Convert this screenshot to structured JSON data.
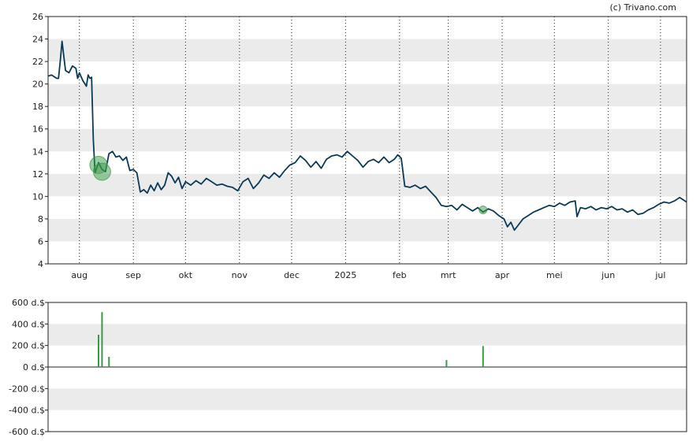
{
  "watermark": "(c) Trivano.com",
  "chart_data": [
    {
      "type": "line",
      "title": "",
      "xlabel": "",
      "ylabel": "",
      "ylim": [
        4,
        26
      ],
      "yticks": [
        "4",
        "6",
        "8",
        "10",
        "12",
        "14",
        "16",
        "18",
        "20",
        "22",
        "24",
        "26"
      ],
      "xlim": [
        "2024-07-14",
        "2025-07-16"
      ],
      "xticks": [
        {
          "label": "aug",
          "date": "2024-08-01"
        },
        {
          "label": "sep",
          "date": "2024-09-01"
        },
        {
          "label": "okt",
          "date": "2024-10-01"
        },
        {
          "label": "nov",
          "date": "2024-11-01"
        },
        {
          "label": "dec",
          "date": "2024-12-01"
        },
        {
          "label": "2025",
          "date": "2025-01-01"
        },
        {
          "label": "feb",
          "date": "2025-02-01"
        },
        {
          "label": "mrt",
          "date": "2025-03-01"
        },
        {
          "label": "apr",
          "date": "2025-04-01"
        },
        {
          "label": "mei",
          "date": "2025-05-01"
        },
        {
          "label": "jun",
          "date": "2025-06-01"
        },
        {
          "label": "jul",
          "date": "2025-07-01"
        }
      ],
      "grid": "vertical dotted lines at months, alternating horizontal bands",
      "line_color": "#0b3a57",
      "series": [
        {
          "points": [
            [
              "2024-07-14",
              20.7
            ],
            [
              "2024-07-16",
              20.8
            ],
            [
              "2024-07-19",
              20.5
            ],
            [
              "2024-07-20",
              20.5
            ],
            [
              "2024-07-21",
              22.0
            ],
            [
              "2024-07-22",
              23.8
            ],
            [
              "2024-07-23",
              22.5
            ],
            [
              "2024-07-24",
              21.2
            ],
            [
              "2024-07-26",
              21.0
            ],
            [
              "2024-07-28",
              21.6
            ],
            [
              "2024-07-30",
              21.4
            ],
            [
              "2024-07-31",
              20.5
            ],
            [
              "2024-08-01",
              21.0
            ],
            [
              "2024-08-03",
              20.3
            ],
            [
              "2024-08-05",
              19.8
            ],
            [
              "2024-08-06",
              20.8
            ],
            [
              "2024-08-07",
              20.5
            ],
            [
              "2024-08-08",
              20.6
            ],
            [
              "2024-08-09",
              15.0
            ],
            [
              "2024-08-10",
              12.1
            ],
            [
              "2024-08-12",
              13.0
            ],
            [
              "2024-08-14",
              12.4
            ],
            [
              "2024-08-16",
              12.2
            ],
            [
              "2024-08-18",
              13.8
            ],
            [
              "2024-08-20",
              14.0
            ],
            [
              "2024-08-22",
              13.5
            ],
            [
              "2024-08-24",
              13.6
            ],
            [
              "2024-08-26",
              13.2
            ],
            [
              "2024-08-28",
              13.5
            ],
            [
              "2024-08-30",
              12.3
            ],
            [
              "2024-09-01",
              12.4
            ],
            [
              "2024-09-03",
              12.1
            ],
            [
              "2024-09-05",
              10.4
            ],
            [
              "2024-09-07",
              10.6
            ],
            [
              "2024-09-09",
              10.3
            ],
            [
              "2024-09-11",
              11.0
            ],
            [
              "2024-09-13",
              10.5
            ],
            [
              "2024-09-15",
              11.2
            ],
            [
              "2024-09-17",
              10.6
            ],
            [
              "2024-09-19",
              11.0
            ],
            [
              "2024-09-21",
              12.1
            ],
            [
              "2024-09-23",
              11.8
            ],
            [
              "2024-09-25",
              11.2
            ],
            [
              "2024-09-27",
              11.7
            ],
            [
              "2024-09-29",
              10.7
            ],
            [
              "2024-10-01",
              11.3
            ],
            [
              "2024-10-04",
              11.0
            ],
            [
              "2024-10-07",
              11.4
            ],
            [
              "2024-10-10",
              11.1
            ],
            [
              "2024-10-13",
              11.6
            ],
            [
              "2024-10-16",
              11.3
            ],
            [
              "2024-10-19",
              11.0
            ],
            [
              "2024-10-22",
              11.1
            ],
            [
              "2024-10-25",
              10.9
            ],
            [
              "2024-10-28",
              10.8
            ],
            [
              "2024-10-31",
              10.5
            ],
            [
              "2024-11-03",
              11.3
            ],
            [
              "2024-11-06",
              11.6
            ],
            [
              "2024-11-09",
              10.7
            ],
            [
              "2024-11-12",
              11.2
            ],
            [
              "2024-11-15",
              11.9
            ],
            [
              "2024-11-18",
              11.6
            ],
            [
              "2024-11-21",
              12.1
            ],
            [
              "2024-11-24",
              11.7
            ],
            [
              "2024-11-27",
              12.3
            ],
            [
              "2024-11-30",
              12.8
            ],
            [
              "2024-12-03",
              13.0
            ],
            [
              "2024-12-06",
              13.6
            ],
            [
              "2024-12-09",
              13.2
            ],
            [
              "2024-12-12",
              12.6
            ],
            [
              "2024-12-15",
              13.1
            ],
            [
              "2024-12-18",
              12.5
            ],
            [
              "2024-12-21",
              13.3
            ],
            [
              "2024-12-24",
              13.6
            ],
            [
              "2024-12-27",
              13.7
            ],
            [
              "2024-12-30",
              13.5
            ],
            [
              "2025-01-02",
              14.0
            ],
            [
              "2025-01-05",
              13.6
            ],
            [
              "2025-01-08",
              13.2
            ],
            [
              "2025-01-11",
              12.6
            ],
            [
              "2025-01-14",
              13.1
            ],
            [
              "2025-01-17",
              13.3
            ],
            [
              "2025-01-20",
              13.0
            ],
            [
              "2025-01-23",
              13.5
            ],
            [
              "2025-01-26",
              13.0
            ],
            [
              "2025-01-29",
              13.3
            ],
            [
              "2025-01-31",
              13.7
            ],
            [
              "2025-02-02",
              13.4
            ],
            [
              "2025-02-04",
              10.9
            ],
            [
              "2025-02-07",
              10.8
            ],
            [
              "2025-02-10",
              11.0
            ],
            [
              "2025-02-13",
              10.7
            ],
            [
              "2025-02-16",
              10.9
            ],
            [
              "2025-02-19",
              10.4
            ],
            [
              "2025-02-22",
              9.9
            ],
            [
              "2025-02-25",
              9.2
            ],
            [
              "2025-02-28",
              9.1
            ],
            [
              "2025-03-03",
              9.2
            ],
            [
              "2025-03-06",
              8.8
            ],
            [
              "2025-03-09",
              9.3
            ],
            [
              "2025-03-12",
              9.0
            ],
            [
              "2025-03-15",
              8.7
            ],
            [
              "2025-03-18",
              9.0
            ],
            [
              "2025-03-21",
              8.6
            ],
            [
              "2025-03-24",
              8.9
            ],
            [
              "2025-03-27",
              8.7
            ],
            [
              "2025-03-30",
              8.3
            ],
            [
              "2025-04-02",
              8.0
            ],
            [
              "2025-04-04",
              7.3
            ],
            [
              "2025-04-06",
              7.7
            ],
            [
              "2025-04-08",
              7.0
            ],
            [
              "2025-04-10",
              7.4
            ],
            [
              "2025-04-13",
              8.0
            ],
            [
              "2025-04-16",
              8.3
            ],
            [
              "2025-04-19",
              8.6
            ],
            [
              "2025-04-22",
              8.8
            ],
            [
              "2025-04-25",
              9.0
            ],
            [
              "2025-04-28",
              9.2
            ],
            [
              "2025-05-01",
              9.1
            ],
            [
              "2025-05-04",
              9.4
            ],
            [
              "2025-05-07",
              9.2
            ],
            [
              "2025-05-10",
              9.5
            ],
            [
              "2025-05-13",
              9.6
            ],
            [
              "2025-05-14",
              8.2
            ],
            [
              "2025-05-16",
              9.0
            ],
            [
              "2025-05-19",
              8.9
            ],
            [
              "2025-05-22",
              9.1
            ],
            [
              "2025-05-25",
              8.8
            ],
            [
              "2025-05-28",
              9.0
            ],
            [
              "2025-05-31",
              8.9
            ],
            [
              "2025-06-03",
              9.1
            ],
            [
              "2025-06-06",
              8.8
            ],
            [
              "2025-06-09",
              8.9
            ],
            [
              "2025-06-12",
              8.6
            ],
            [
              "2025-06-15",
              8.8
            ],
            [
              "2025-06-18",
              8.4
            ],
            [
              "2025-06-21",
              8.5
            ],
            [
              "2025-06-24",
              8.8
            ],
            [
              "2025-06-27",
              9.0
            ],
            [
              "2025-06-30",
              9.3
            ],
            [
              "2025-07-03",
              9.5
            ],
            [
              "2025-07-06",
              9.4
            ],
            [
              "2025-07-09",
              9.6
            ],
            [
              "2025-07-12",
              9.9
            ],
            [
              "2025-07-16",
              9.5
            ]
          ]
        }
      ],
      "markers": [
        {
          "date": "2024-08-12",
          "value": 12.8,
          "size": "large",
          "color": "#3a9a45"
        },
        {
          "date": "2024-08-14",
          "value": 12.2,
          "size": "large",
          "color": "#3a9a45"
        },
        {
          "date": "2025-03-21",
          "value": 8.8,
          "size": "small",
          "color": "#3a9a45"
        }
      ]
    },
    {
      "type": "bar",
      "title": "",
      "xlabel": "",
      "ylabel": "",
      "ylim": [
        -600,
        600
      ],
      "yticks": [
        "-600 d.$",
        "-400 d.$",
        "-200 d.$",
        "0 d.$",
        "200 d.$",
        "400 d.$",
        "600 d.$"
      ],
      "bar_color": "#3a9a45",
      "bars": [
        {
          "date": "2024-08-12",
          "value": 300
        },
        {
          "date": "2024-08-14",
          "value": 510
        },
        {
          "date": "2024-08-18",
          "value": 95
        },
        {
          "date": "2025-02-28",
          "value": 65
        },
        {
          "date": "2025-03-21",
          "value": 195
        }
      ]
    }
  ]
}
